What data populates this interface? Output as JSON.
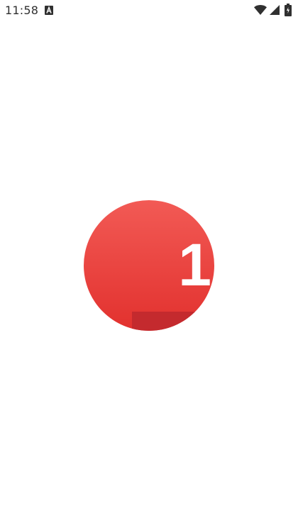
{
  "status_bar": {
    "time": "11:58",
    "icons": [
      "notification-a-icon",
      "wifi-icon",
      "cell-signal-icon",
      "battery-icon"
    ]
  },
  "splash": {
    "logo_number": "1",
    "colors": {
      "circle_top": "#f25a55",
      "circle_bottom": "#e2312e",
      "fold": "#c42a2e",
      "number": "#ffffff"
    }
  }
}
